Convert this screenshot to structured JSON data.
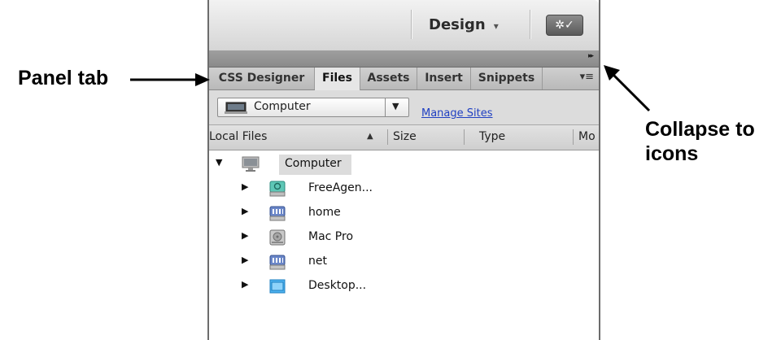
{
  "callouts": {
    "panel_tab": "Panel tab",
    "collapse_to_icons": "Collapse to icons"
  },
  "header": {
    "workspace": "Design",
    "workspace_caret": "▾",
    "sync_button": "✲✓",
    "collapse_glyph": "▸▸"
  },
  "tabs": [
    {
      "label": "CSS Designer",
      "active": false
    },
    {
      "label": "Files",
      "active": true
    },
    {
      "label": "Assets",
      "active": false
    },
    {
      "label": "Insert",
      "active": false
    },
    {
      "label": "Snippets",
      "active": false
    }
  ],
  "tab_menu": "▾≡",
  "toolbar": {
    "site_select_value": "Computer",
    "site_select_arrow": "▼",
    "manage_sites": "Manage Sites"
  },
  "columns": [
    "Local Files",
    "Size",
    "Type",
    "Mo"
  ],
  "sort_indicator": "▲",
  "tree": {
    "root": {
      "label": "Computer",
      "icon": "computer-icon",
      "twisty": "▼"
    },
    "items": [
      {
        "label": "FreeAgen...",
        "icon": "external-drive-icon",
        "twisty": "▶"
      },
      {
        "label": "home",
        "icon": "network-drive-icon",
        "twisty": "▶"
      },
      {
        "label": "Mac Pro",
        "icon": "hard-drive-icon",
        "twisty": "▶"
      },
      {
        "label": "net",
        "icon": "network-drive-icon",
        "twisty": "▶"
      },
      {
        "label": "Desktop...",
        "icon": "folder-icon",
        "twisty": "▶"
      }
    ]
  },
  "colors": {
    "link": "#1f3fc2",
    "folder": "#4fb3f0",
    "external_drive": "#33b4a0"
  }
}
